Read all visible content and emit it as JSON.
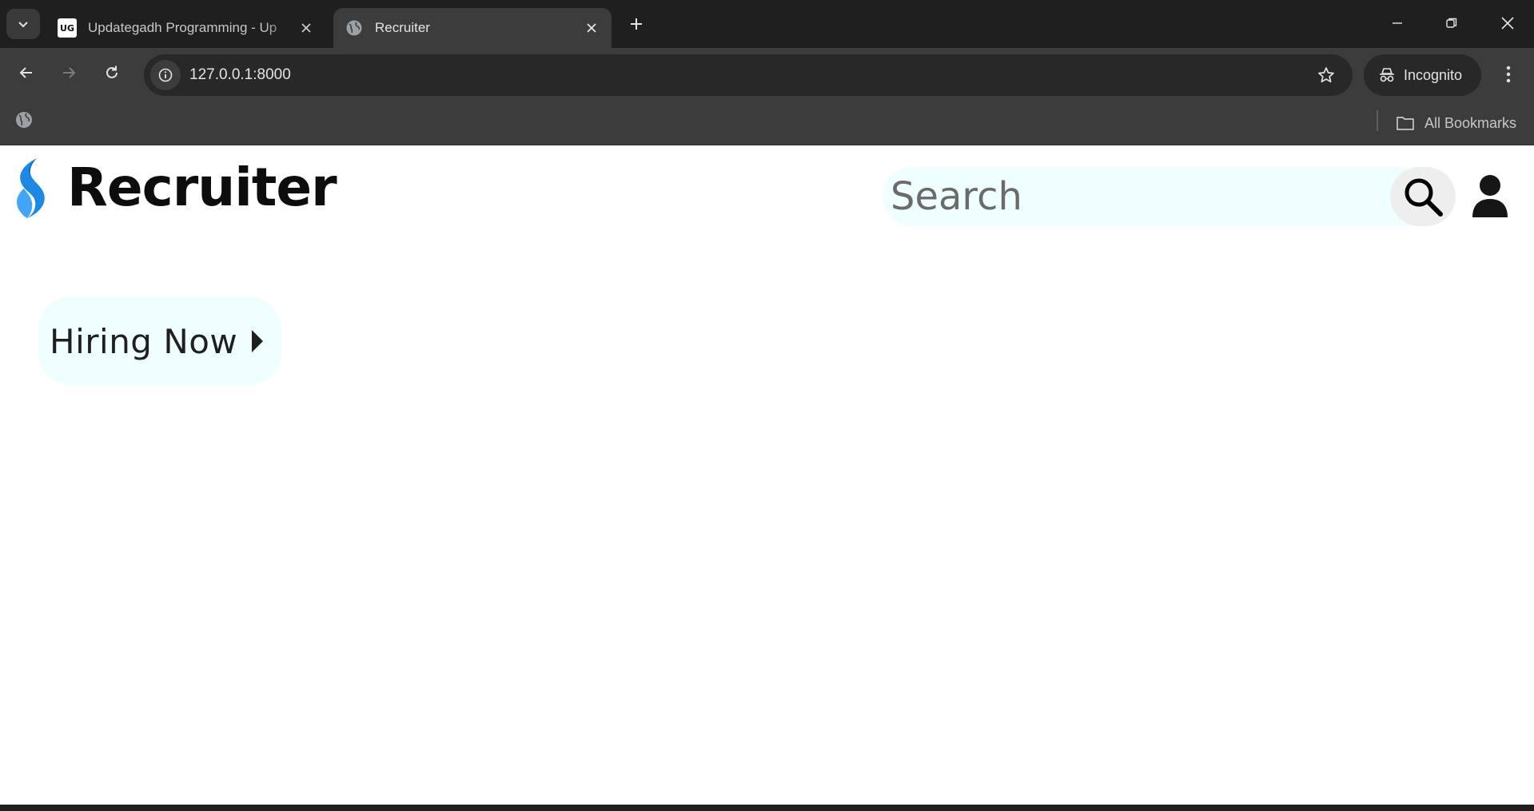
{
  "browser": {
    "tabs": [
      {
        "title": "Updategadh Programming - Up",
        "favicon": "ug-logo-icon",
        "active": false
      },
      {
        "title": "Recruiter",
        "favicon": "globe-icon",
        "active": true
      }
    ],
    "url": "127.0.0.1:8000",
    "profile_label": "Incognito",
    "all_bookmarks_label": "All Bookmarks"
  },
  "header": {
    "brand_name": "Recruiter",
    "search_placeholder": "Search"
  },
  "main": {
    "hiring_button_label": "Hiring Now"
  },
  "colors": {
    "chrome_dark": "#1f1f1f",
    "chrome_toolbar": "#3c3c3c",
    "search_bg": "#efffff",
    "logo_blue": "#1e88e5",
    "logo_light_blue": "#42a5f5"
  }
}
